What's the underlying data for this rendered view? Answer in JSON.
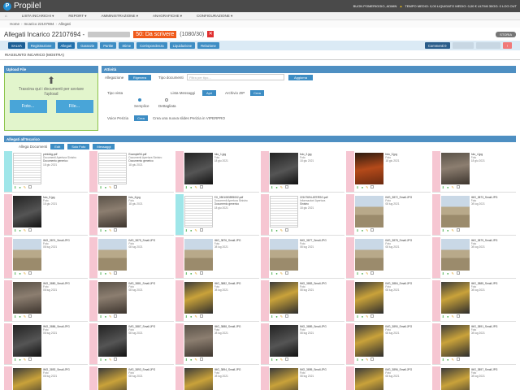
{
  "app": {
    "name": "Propilel"
  },
  "topbar": {
    "user_text": "BUON POMERIGGIO, ADMIN",
    "stats_text": "TEMPO MEDIO: 0,00 LIQUIDATO MEDIO: 0,00 € ULTIMI 30GG: 0 LOG OUT"
  },
  "nav": [
    "LISTA INCARICHI ▾",
    "REPORT ▾",
    "AMMINISTRAZIONE ▾",
    "ANAGRAFICHE ▾",
    "CONFIGURAZIONE ▾"
  ],
  "breadcrumb": {
    "home": "Home",
    "incarico": "Incarico 22107694",
    "current": "Allegati"
  },
  "header": {
    "title": "Allegati Incarico 22107694 -",
    "status": "50: Da scrivere",
    "count": "(1080/30)",
    "storia": "STORIA"
  },
  "tabs": [
    "SALVA",
    "Registrazione",
    "Allegati",
    "Garanzie",
    "Partite",
    "Stime",
    "Corrispondenza",
    "Liquidazione",
    "Relazione"
  ],
  "tabs_right": {
    "commenti": "Commenti",
    "commenti_badge": "0"
  },
  "riassunto": "RIASSUNTO INCARICO (MOSTRA)",
  "upload": {
    "header": "Upload File",
    "text": "Trascina qui i documenti per avviare l'upload",
    "foto": "Foto...",
    "file": "File..."
  },
  "attivita": {
    "header": "Attività",
    "allegazione": "Allegazione",
    "rigenera": "Rigenera",
    "tipo_documenti": "Tipo documenti",
    "filtra_placeholder": "Filtra per tipo...",
    "aggiorna": "Aggiorna",
    "tipo_vista": "Tipo vista",
    "lista_messaggi": "Lista Messaggi",
    "apri": "Apri",
    "archivio_zip": "Archivio ZIP",
    "crea": "Crea",
    "semplice": "Semplice",
    "dettagliata": "Dettagliata",
    "voice_perizia": "Voice Perizia",
    "crea2": "Crea",
    "crea_text": "Crea una nuova slides Perizia in VIPERPRO"
  },
  "allegati": {
    "header": "Allegati all'Incarico",
    "allega_label": "Allega Documenti",
    "edit": "Edit",
    "solo_foto": "Solo Foto",
    "messaggi": "Messaggi"
  },
  "cards": [
    {
      "name": "print4dg.pdf",
      "type": "Documenti Apertura Sinistro",
      "sub": "Documento generico",
      "date": "18 giu 2021",
      "kind": "doc",
      "strip": "cyan"
    },
    {
      "name": "Example94.pdf",
      "type": "Documenti Apertura Sinistro",
      "sub": "Documento generico",
      "date": "18 giu 2021",
      "kind": "doc",
      "strip": "pink"
    },
    {
      "name": "foto_1.jpg",
      "type": "Foto",
      "sub": "",
      "date": "18 giu 2021",
      "kind": "dark",
      "strip": "pink"
    },
    {
      "name": "foto_2.jpg",
      "type": "Foto",
      "sub": "",
      "date": "18 giu 2021",
      "kind": "dark",
      "strip": "pink"
    },
    {
      "name": "foto_3.jpg",
      "type": "Foto",
      "sub": "",
      "date": "18 giu 2021",
      "kind": "fire",
      "strip": "pink"
    },
    {
      "name": "foto_4.jpg",
      "type": "Foto",
      "sub": "",
      "date": "18 giu 2021",
      "kind": "ruin",
      "strip": "pink"
    },
    {
      "name": "foto_5.jpg",
      "type": "Foto",
      "sub": "",
      "date": "18 giu 2021",
      "kind": "dark",
      "strip": "pink"
    },
    {
      "name": "foto_6.jpg",
      "type": "Foto",
      "sub": "",
      "date": "18 giu 2021",
      "kind": "ruin",
      "strip": "pink"
    },
    {
      "name": "EX_0501083595002.pdf",
      "type": "Documenti Apertura Sinistro",
      "sub": "Documento generico",
      "date": "18 giu 2021",
      "kind": "doc",
      "strip": "cyan"
    },
    {
      "name": "22107694.ATERSG.pdf",
      "type": "Informazioni Apertura",
      "sub": "Sinistro",
      "date": "18 giu 2021",
      "kind": "doc",
      "strip": "pink"
    },
    {
      "name": "IMG_3872_Small.JPG",
      "type": "Foto",
      "sub": "",
      "date": "08 lug 2021",
      "kind": "field",
      "strip": "pink"
    },
    {
      "name": "IMG_3873_Small.JPG",
      "type": "Foto",
      "sub": "",
      "date": "08 lug 2021",
      "kind": "field",
      "strip": "pink"
    },
    {
      "name": "IMG_3874_Small.JPG",
      "type": "Foto",
      "sub": "",
      "date": "08 lug 2021",
      "kind": "field",
      "strip": "pink"
    },
    {
      "name": "IMG_3875_Small.JPG",
      "type": "Foto",
      "sub": "",
      "date": "08 lug 2021",
      "kind": "field",
      "strip": "pink"
    },
    {
      "name": "IMG_3876_Small.JPG",
      "type": "Foto",
      "sub": "",
      "date": "08 lug 2021",
      "kind": "field",
      "strip": "pink"
    },
    {
      "name": "IMG_3877_Small.JPG",
      "type": "Foto",
      "sub": "",
      "date": "08 lug 2021",
      "kind": "field",
      "strip": "pink"
    },
    {
      "name": "IMG_3878_Small.JPG",
      "type": "Foto",
      "sub": "",
      "date": "08 lug 2021",
      "kind": "field",
      "strip": "pink"
    },
    {
      "name": "IMG_3879_Small.JPG",
      "type": "Foto",
      "sub": "",
      "date": "08 lug 2021",
      "kind": "field",
      "strip": "pink"
    },
    {
      "name": "IMG_3880_Small.JPG",
      "type": "Foto",
      "sub": "",
      "date": "08 lug 2021",
      "kind": "ruin",
      "strip": "pink"
    },
    {
      "name": "IMG_3881_Small.JPG",
      "type": "Foto",
      "sub": "",
      "date": "08 lug 2021",
      "kind": "ruin",
      "strip": "pink"
    },
    {
      "name": "IMG_3882_Small.JPG",
      "type": "Foto",
      "sub": "",
      "date": "08 lug 2021",
      "kind": "mach",
      "strip": "pink"
    },
    {
      "name": "IMG_3883_Small.JPG",
      "type": "Foto",
      "sub": "",
      "date": "08 lug 2021",
      "kind": "mach",
      "strip": "pink"
    },
    {
      "name": "IMG_3884_Small.JPG",
      "type": "Foto",
      "sub": "",
      "date": "08 lug 2021",
      "kind": "mach",
      "strip": "pink"
    },
    {
      "name": "IMG_3885_Small.JPG",
      "type": "Foto",
      "sub": "",
      "date": "08 lug 2021",
      "kind": "mach",
      "strip": "pink"
    },
    {
      "name": "IMG_3886_Small.JPG",
      "type": "Foto",
      "sub": "",
      "date": "08 lug 2021",
      "kind": "dark",
      "strip": "pink"
    },
    {
      "name": "IMG_3887_Small.JPG",
      "type": "Foto",
      "sub": "",
      "date": "08 lug 2021",
      "kind": "dark",
      "strip": "pink"
    },
    {
      "name": "IMG_3888_Small.JPG",
      "type": "Foto",
      "sub": "",
      "date": "08 lug 2021",
      "kind": "ruin",
      "strip": "pink"
    },
    {
      "name": "IMG_3889_Small.JPG",
      "type": "Foto",
      "sub": "",
      "date": "08 lug 2021",
      "kind": "dark",
      "strip": "pink"
    },
    {
      "name": "IMG_3890_Small.JPG",
      "type": "Foto",
      "sub": "",
      "date": "08 lug 2021",
      "kind": "mach",
      "strip": "pink"
    },
    {
      "name": "IMG_3891_Small.JPG",
      "type": "Foto",
      "sub": "",
      "date": "08 lug 2021",
      "kind": "mach",
      "strip": "pink"
    },
    {
      "name": "IMG_3892_Small.JPG",
      "type": "Foto",
      "sub": "",
      "date": "08 lug 2021",
      "kind": "mach",
      "strip": "pink"
    },
    {
      "name": "IMG_3893_Small.JPG",
      "type": "Foto",
      "sub": "",
      "date": "08 lug 2021",
      "kind": "mach",
      "strip": "pink"
    },
    {
      "name": "IMG_3894_Small.JPG",
      "type": "Foto",
      "sub": "",
      "date": "08 lug 2021",
      "kind": "mach",
      "strip": "pink"
    },
    {
      "name": "IMG_3895_Small.JPG",
      "type": "Foto",
      "sub": "",
      "date": "08 lug 2021",
      "kind": "mach",
      "strip": "pink"
    },
    {
      "name": "IMG_3896_Small.JPG",
      "type": "Foto",
      "sub": "",
      "date": "08 lug 2021",
      "kind": "mach",
      "strip": "pink"
    },
    {
      "name": "IMG_3897_Small.JPG",
      "type": "Foto",
      "sub": "",
      "date": "08 lug 2021",
      "kind": "mach",
      "strip": "pink"
    }
  ],
  "colors": {
    "accent": "#3d8dc4",
    "status": "#f05a1a",
    "upload_bg": "#e2f5cc"
  }
}
